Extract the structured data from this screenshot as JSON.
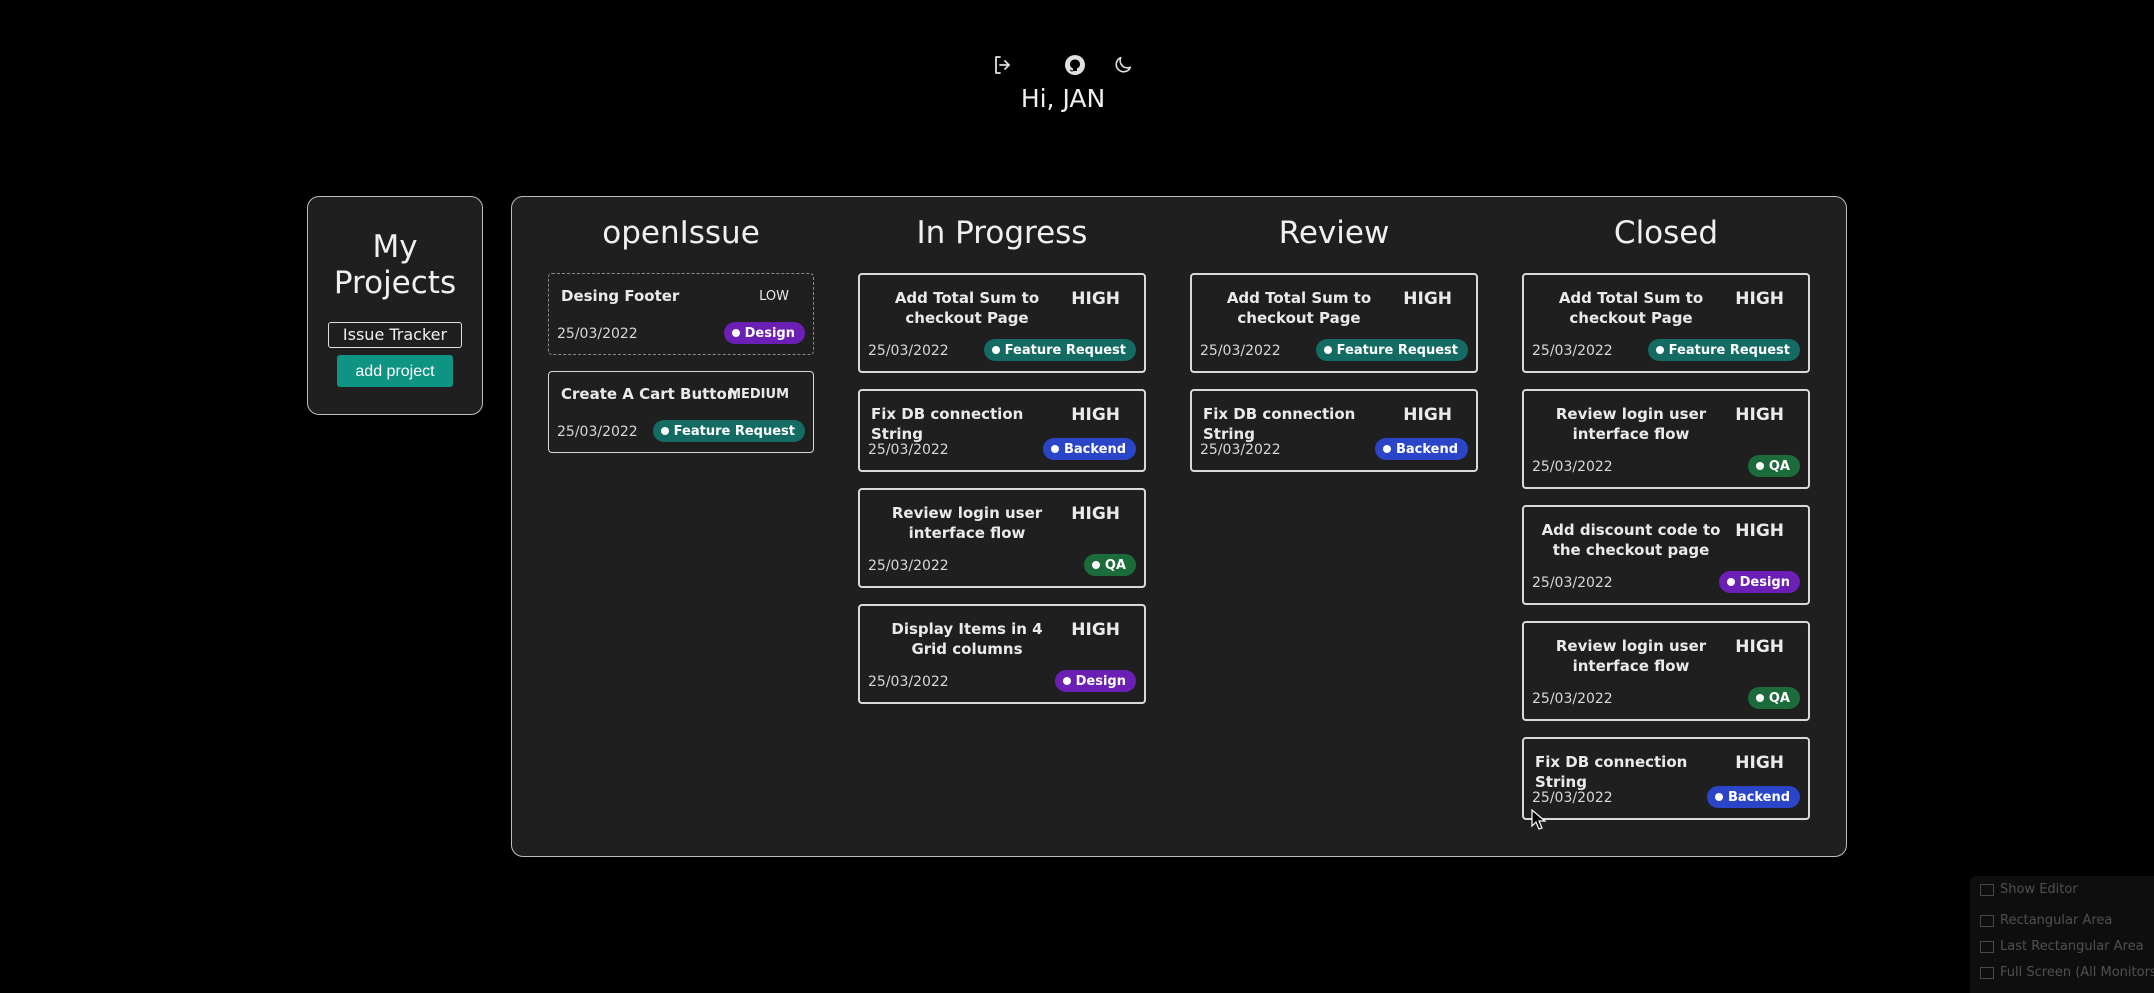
{
  "header": {
    "greeting": "Hi, JAN",
    "icons": [
      "logout-icon",
      "github-icon",
      "moon-icon"
    ]
  },
  "sidebar": {
    "title": "My Projects",
    "projects": [
      {
        "label": "Issue Tracker"
      }
    ],
    "add_label": "add project"
  },
  "board": {
    "columns": [
      {
        "title": "openIssue",
        "cards": [
          {
            "title": "Desing Footer",
            "priority": "LOW",
            "date": "25/03/2022",
            "tag": "Design"
          },
          {
            "title": "Create A Cart Button",
            "priority": "MEDIUM",
            "date": "25/03/2022",
            "tag": "Feature Request"
          }
        ]
      },
      {
        "title": "In Progress",
        "cards": [
          {
            "title": "Add Total Sum to checkout Page",
            "priority": "HIGH",
            "date": "25/03/2022",
            "tag": "Feature Request"
          },
          {
            "title": "Fix DB connection String",
            "priority": "HIGH",
            "date": "25/03/2022",
            "tag": "Backend"
          },
          {
            "title": "Review login user interface flow",
            "priority": "HIGH",
            "date": "25/03/2022",
            "tag": "QA"
          },
          {
            "title": "Display Items in 4 Grid columns",
            "priority": "HIGH",
            "date": "25/03/2022",
            "tag": "Design"
          }
        ]
      },
      {
        "title": "Review",
        "cards": [
          {
            "title": "Add Total Sum to checkout Page",
            "priority": "HIGH",
            "date": "25/03/2022",
            "tag": "Feature Request"
          },
          {
            "title": "Fix DB connection String",
            "priority": "HIGH",
            "date": "25/03/2022",
            "tag": "Backend"
          }
        ]
      },
      {
        "title": "Closed",
        "cards": [
          {
            "title": "Add Total Sum to checkout Page",
            "priority": "HIGH",
            "date": "25/03/2022",
            "tag": "Feature Request"
          },
          {
            "title": "Review login user interface flow",
            "priority": "HIGH",
            "date": "25/03/2022",
            "tag": "QA"
          },
          {
            "title": "Add discount code to the checkout page",
            "priority": "HIGH",
            "date": "25/03/2022",
            "tag": "Design"
          },
          {
            "title": "Review login user interface flow",
            "priority": "HIGH",
            "date": "25/03/2022",
            "tag": "QA"
          },
          {
            "title": "Fix DB connection String",
            "priority": "HIGH",
            "date": "25/03/2022",
            "tag": "Backend"
          }
        ]
      }
    ]
  },
  "tool_menu": {
    "items": [
      "Show Editor",
      "Rectangular Area",
      "Last Rectangular Area",
      "Full Screen (All Monitors)"
    ]
  },
  "colors": {
    "feature_request": "#146b63",
    "design": "#6b1fb4",
    "backend": "#2a45c7",
    "qa": "#1c6b3b",
    "add_project": "#0f9383"
  }
}
